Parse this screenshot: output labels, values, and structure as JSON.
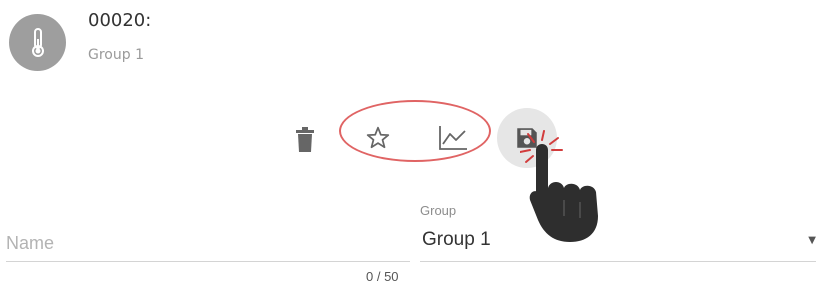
{
  "device": {
    "id": "00020:",
    "group": "Group 1",
    "icon": "thermometer-icon"
  },
  "toolbar": {
    "delete_icon": "trash-icon",
    "favorite_icon": "star-outline-icon",
    "chart_icon": "line-chart-icon",
    "save_icon": "save-floppy-icon",
    "highlight_color": "#e06464"
  },
  "form": {
    "name": {
      "placeholder": "Name",
      "value": "",
      "counter": "0 / 50"
    },
    "group": {
      "label": "Group",
      "selected": "Group 1"
    }
  }
}
